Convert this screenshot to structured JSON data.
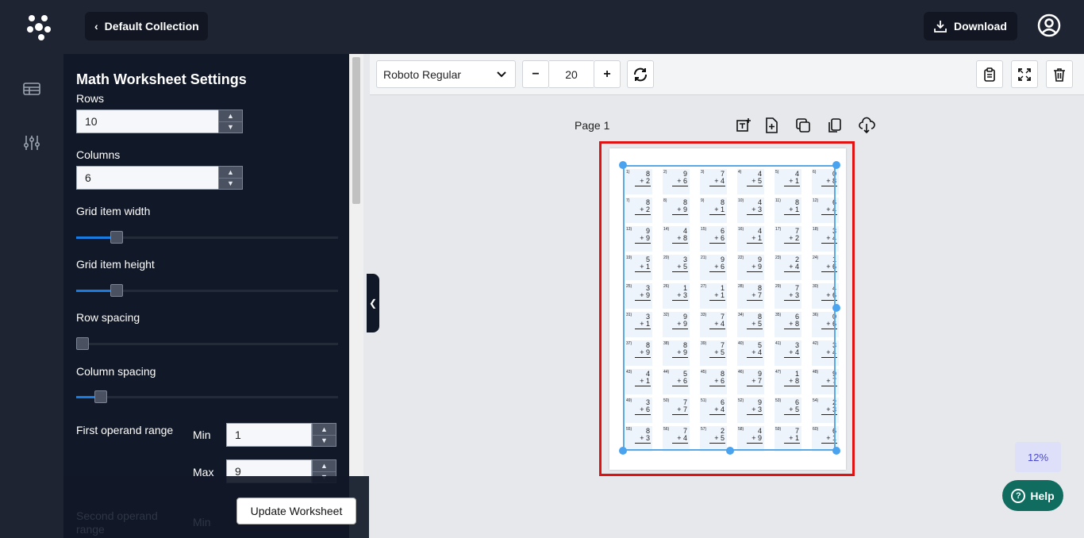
{
  "header": {
    "back_label": "Default Collection",
    "download_label": "Download"
  },
  "settings": {
    "title": "Math Worksheet Settings",
    "rows_label": "Rows",
    "rows_value": "10",
    "columns_label": "Columns",
    "columns_value": "6",
    "grid_item_width_label": "Grid item width",
    "grid_item_width_level": 0.13,
    "grid_item_height_label": "Grid item height",
    "grid_item_height_level": 0.13,
    "row_spacing_label": "Row spacing",
    "row_spacing_level": 0.0,
    "column_spacing_label": "Column spacing",
    "column_spacing_level": 0.07,
    "first_operand_label": "First operand range",
    "min_label": "Min",
    "min_value": "1",
    "max_label": "Max",
    "max_value": "9",
    "second_operand_label": "Second operand range",
    "second_min_label": "Min",
    "update_label": "Update Worksheet"
  },
  "toolbar": {
    "font": "Roboto Regular",
    "font_size": "20",
    "minus_label": "−",
    "plus_label": "+"
  },
  "canvas": {
    "page_label": "Page 1",
    "zoom": "12%",
    "problems": [
      [
        8,
        2
      ],
      [
        9,
        6
      ],
      [
        7,
        4
      ],
      [
        4,
        5
      ],
      [
        4,
        1
      ],
      [
        0,
        8
      ],
      [
        8,
        2
      ],
      [
        8,
        9
      ],
      [
        8,
        1
      ],
      [
        4,
        3
      ],
      [
        8,
        1
      ],
      [
        6,
        4
      ],
      [
        9,
        9
      ],
      [
        4,
        8
      ],
      [
        6,
        6
      ],
      [
        4,
        1
      ],
      [
        7,
        2
      ],
      [
        3,
        4
      ],
      [
        5,
        1
      ],
      [
        3,
        5
      ],
      [
        9,
        6
      ],
      [
        9,
        9
      ],
      [
        2,
        4
      ],
      [
        1,
        6
      ],
      [
        3,
        9
      ],
      [
        1,
        3
      ],
      [
        1,
        1
      ],
      [
        8,
        7
      ],
      [
        7,
        3
      ],
      [
        4,
        6
      ],
      [
        3,
        1
      ],
      [
        9,
        9
      ],
      [
        7,
        4
      ],
      [
        8,
        5
      ],
      [
        6,
        8
      ],
      [
        0,
        6
      ],
      [
        8,
        9
      ],
      [
        8,
        9
      ],
      [
        7,
        5
      ],
      [
        5,
        4
      ],
      [
        3,
        4
      ],
      [
        3,
        4
      ],
      [
        4,
        1
      ],
      [
        5,
        6
      ],
      [
        8,
        6
      ],
      [
        9,
        7
      ],
      [
        1,
        8
      ],
      [
        9,
        7
      ],
      [
        3,
        6
      ],
      [
        7,
        7
      ],
      [
        6,
        4
      ],
      [
        9,
        3
      ],
      [
        6,
        5
      ],
      [
        2,
        3
      ],
      [
        8,
        3
      ],
      [
        7,
        4
      ],
      [
        2,
        5
      ],
      [
        4,
        9
      ],
      [
        7,
        1
      ],
      [
        6,
        1
      ]
    ]
  },
  "help": {
    "label": "Help"
  }
}
